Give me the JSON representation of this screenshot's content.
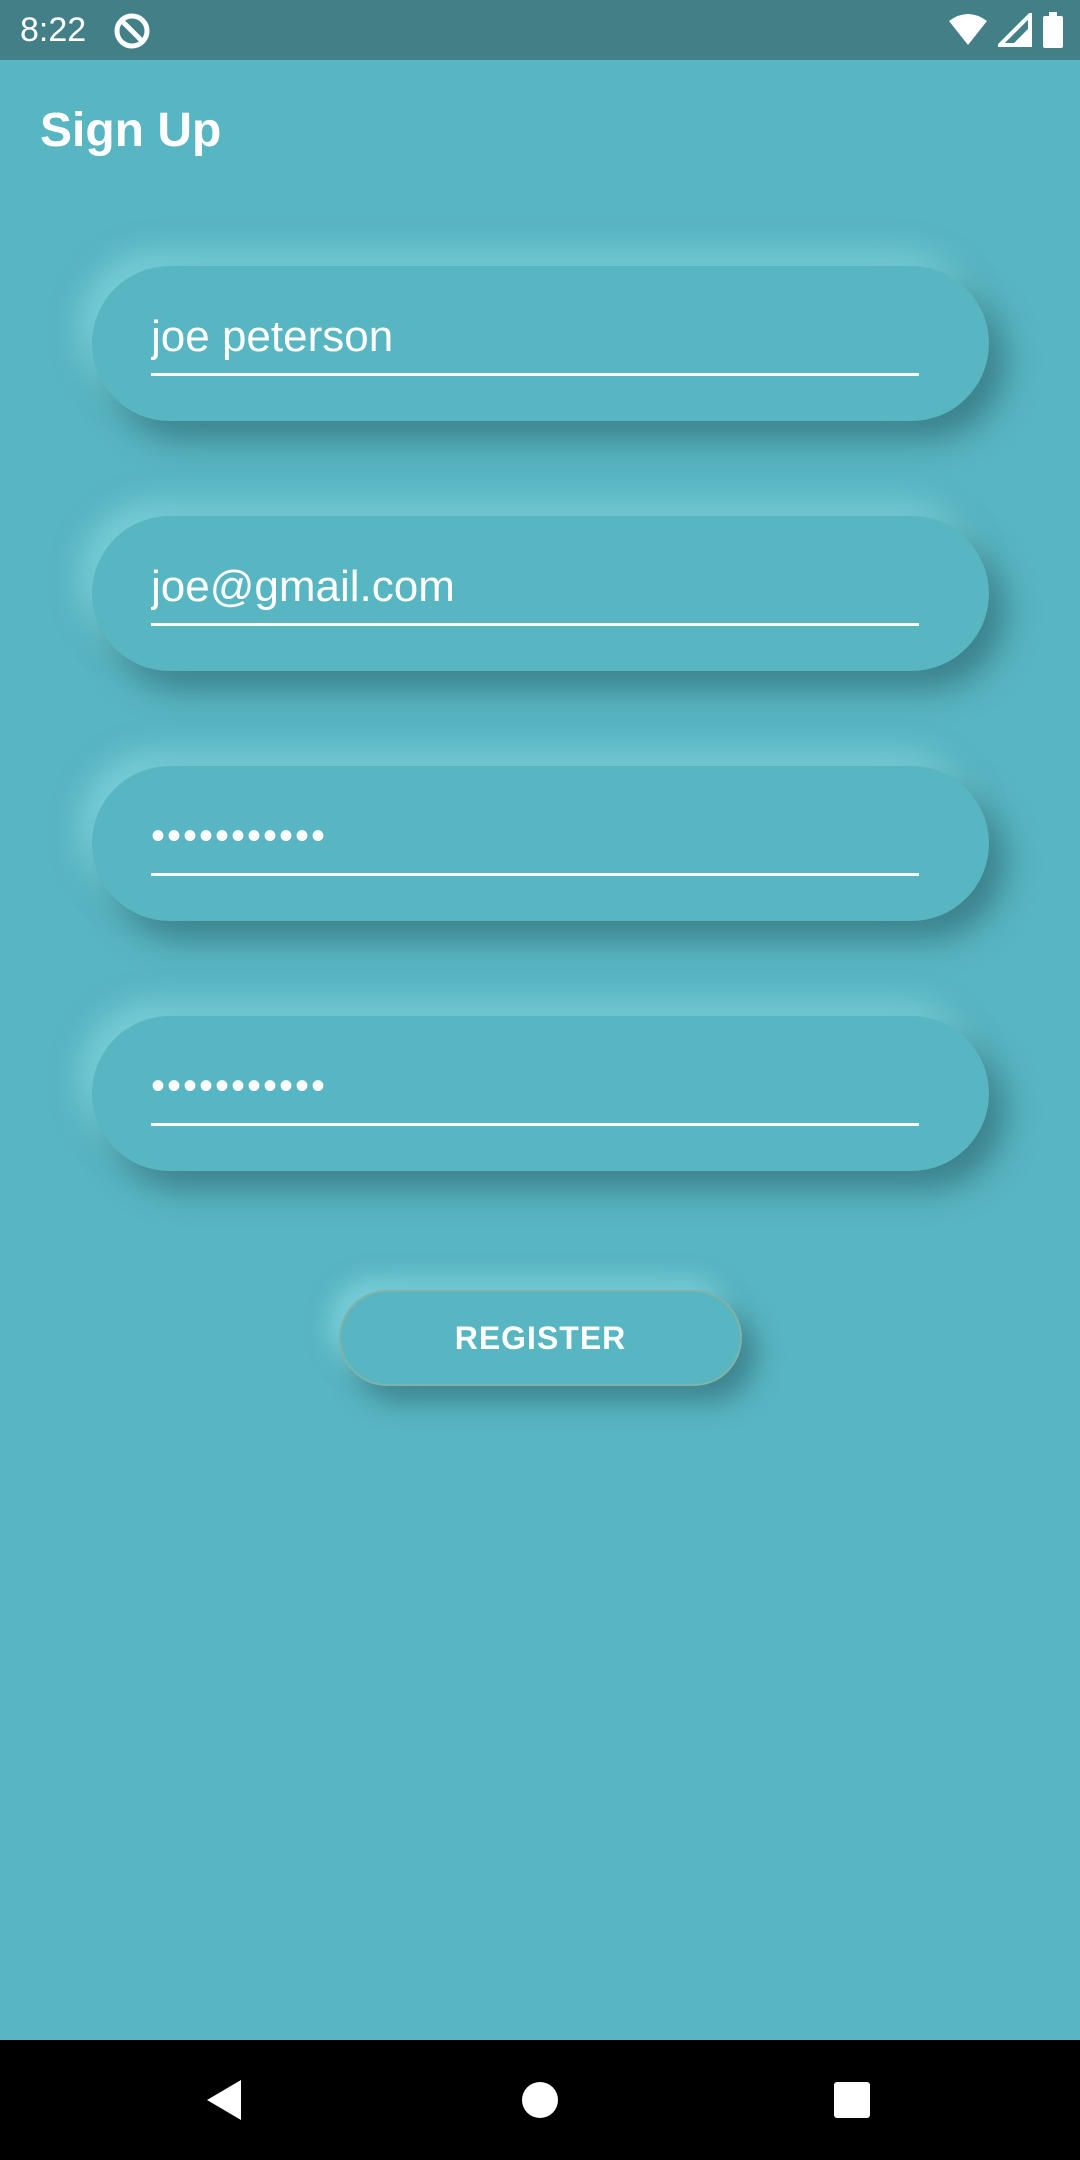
{
  "status_bar": {
    "time": "8:22",
    "app_icon": "no-disturb-icon",
    "icons": [
      "wifi-icon",
      "signal-icon",
      "battery-icon"
    ]
  },
  "header": {
    "title": "Sign Up"
  },
  "form": {
    "name_value": "joe peterson",
    "email_value": "joe@gmail.com",
    "password_value": "•••••••••••",
    "confirm_password_value": "•••••••••••",
    "register_label": "REGISTER"
  },
  "nav_bar": {
    "icons": [
      "back-icon",
      "home-icon",
      "recents-icon"
    ]
  },
  "colors": {
    "background": "#58b5c2",
    "status_bar": "#427f87",
    "nav_bar": "#000000",
    "text": "#ffffff"
  }
}
